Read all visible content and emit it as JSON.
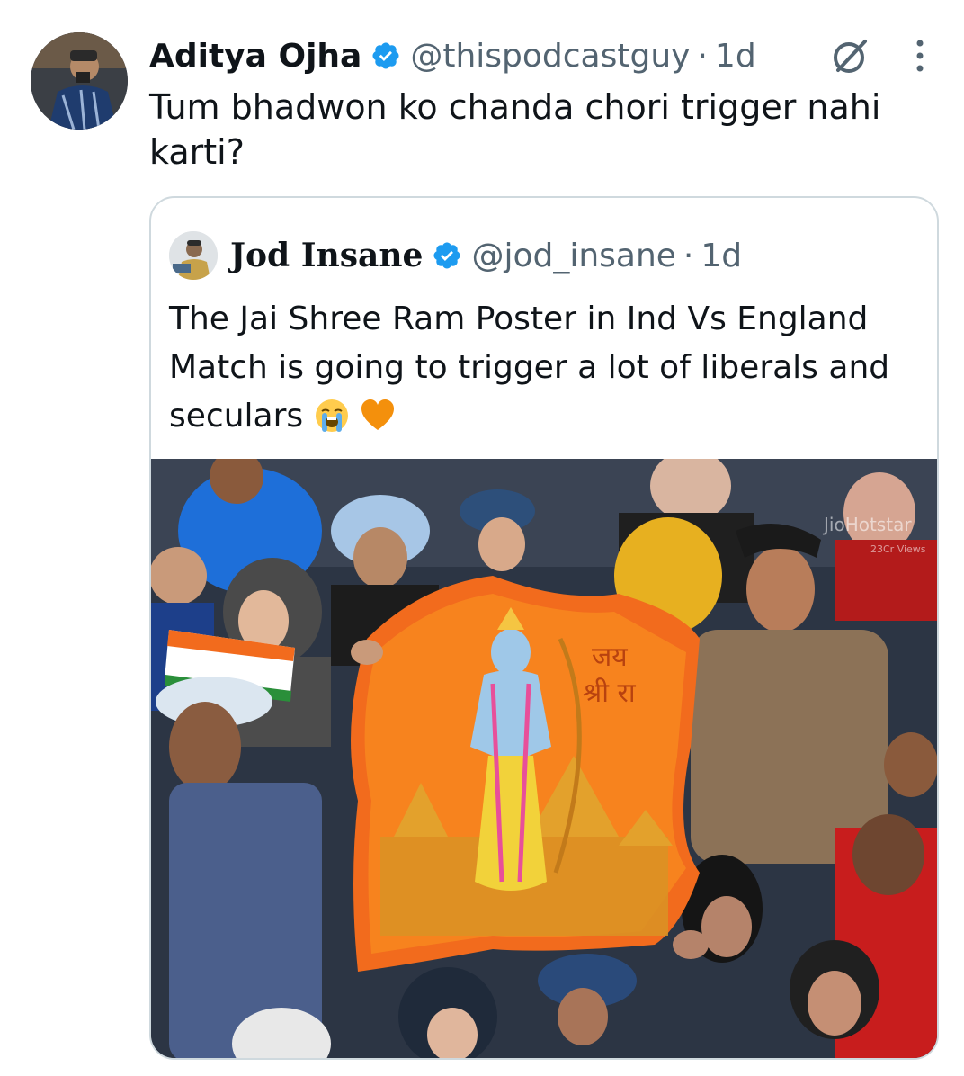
{
  "tweet": {
    "author_name": "Aditya Ojha",
    "handle": "@thispodcastguy",
    "separator": "·",
    "time": "1d",
    "text": "Tum bhadwon ko chanda chori trigger nahi karti?",
    "icons": {
      "grok": "grok-icon",
      "more": "more-options-icon",
      "verified": "verified-badge-icon"
    }
  },
  "quote": {
    "author_name": "Jod Insane",
    "handle": "@jod_insane",
    "separator": "·",
    "time": "1d",
    "text": "The Jai Shree Ram Poster in Ind Vs England Match is going to trigger a lot of liberals and seculars",
    "emojis": [
      "😭",
      "🧡"
    ],
    "media": {
      "poster_text": "जय श्री राम",
      "watermark": "JioHotstar",
      "watermark_sub": "23Cr Views"
    }
  },
  "colors": {
    "text_primary": "#0f1419",
    "text_secondary": "#536471",
    "verified_blue": "#1d9bf0",
    "border": "#cfd9de",
    "poster_orange": "#f26b1d"
  }
}
